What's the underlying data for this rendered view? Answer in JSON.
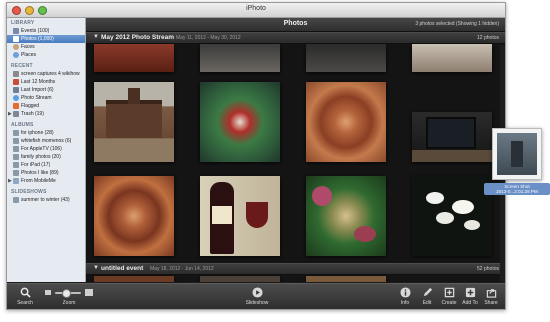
{
  "window": {
    "title": "iPhoto"
  },
  "sidebar": {
    "sections": [
      {
        "header": "LIBRARY",
        "items": [
          {
            "label": "Events (100)",
            "icon": "events-icon",
            "color": "#7a8aa6",
            "selected": false
          },
          {
            "label": "Photos (1,000)",
            "icon": "photos-icon",
            "color": "#ffffff",
            "selected": true
          },
          {
            "label": "Faces",
            "icon": "faces-icon",
            "color": "#c9a27a",
            "selected": false
          },
          {
            "label": "Places",
            "icon": "places-icon",
            "color": "#6fa0d8",
            "selected": false
          }
        ]
      },
      {
        "header": "RECENT",
        "items": [
          {
            "label": "screen captures 4 wikihow",
            "icon": "event-icon",
            "color": "#8a8a8a",
            "selected": false
          },
          {
            "label": "Last 12 Months",
            "icon": "calendar-icon",
            "color": "#cc4c3c",
            "selected": false
          },
          {
            "label": "Last Import (6)",
            "icon": "import-icon",
            "color": "#6f7f95",
            "selected": false
          },
          {
            "label": "Photo Stream",
            "icon": "photo-stream-icon",
            "color": "#5aa0dd",
            "selected": false
          },
          {
            "label": "Flagged",
            "icon": "flag-icon",
            "color": "#e86a2a",
            "selected": false
          },
          {
            "label": "Trash (19)",
            "icon": "trash-icon",
            "color": "#7d8796",
            "selected": false,
            "disclosure": true
          }
        ]
      },
      {
        "header": "ALBUMS",
        "items": [
          {
            "label": "for iphone (28)",
            "icon": "album-icon",
            "color": "#8899aa",
            "selected": false
          },
          {
            "label": "whitefish momenos (6)",
            "icon": "album-icon",
            "color": "#8899aa",
            "selected": false
          },
          {
            "label": "For AppleTV (106)",
            "icon": "album-icon",
            "color": "#8899aa",
            "selected": false
          },
          {
            "label": "family photos (20)",
            "icon": "album-icon",
            "color": "#8899aa",
            "selected": false
          },
          {
            "label": "For iPad (17)",
            "icon": "album-icon",
            "color": "#8899aa",
            "selected": false
          },
          {
            "label": "Photos I like (89)",
            "icon": "album-icon",
            "color": "#8899aa",
            "selected": false
          },
          {
            "label": "From MobileMe",
            "icon": "folder-icon",
            "color": "#8fa7c4",
            "selected": false,
            "disclosure": true
          }
        ]
      },
      {
        "header": "SLIDESHOWS",
        "items": [
          {
            "label": "summer to winter (43)",
            "icon": "slideshow-icon",
            "color": "#8899aa",
            "selected": false
          }
        ]
      }
    ]
  },
  "main": {
    "title": "Photos",
    "status": "3 photos selected (Showing 1 hidden)",
    "events": [
      {
        "name": "May 2012 Photo Stream",
        "date": "May 11, 2012 - May 30, 2012",
        "count": "12 photos"
      },
      {
        "name": "untitled event",
        "date": "May 18, 2012 - Jun 14, 2012",
        "count": "52 photos"
      }
    ]
  },
  "toolbar": {
    "search": "Search",
    "zoom": "Zoom",
    "slideshow": "Slideshow",
    "info": "Info",
    "edit": "Edit",
    "create": "Create",
    "add_to": "Add To",
    "share": "Share"
  },
  "drag_preview": {
    "label_line1": "Screen Shot",
    "label_line2": "2013-0...2:01:28 PM"
  },
  "colors": {
    "selection": "#4a7cbf",
    "toolbar": "#3a3a3a",
    "viewer_bg": "#141414"
  }
}
